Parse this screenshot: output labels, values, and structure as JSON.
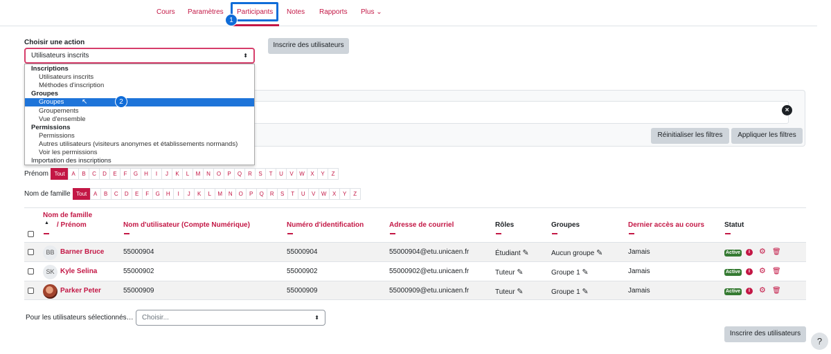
{
  "nav": {
    "items": [
      "Cours",
      "Paramètres",
      "Participants",
      "Notes",
      "Rapports",
      "Plus"
    ],
    "plus_caret": "⌄",
    "step1": "1"
  },
  "action": {
    "label": "Choisir une action",
    "selected": "Utilisateurs inscrits",
    "enrol_button": "Inscrire des utilisateurs"
  },
  "dropdown": {
    "rows": [
      {
        "type": "head",
        "label": "Inscriptions"
      },
      {
        "type": "item",
        "label": "Utilisateurs inscrits"
      },
      {
        "type": "item",
        "label": "Méthodes d'inscription"
      },
      {
        "type": "head",
        "label": "Groupes"
      },
      {
        "type": "sel",
        "label": "Groupes"
      },
      {
        "type": "item",
        "label": "Groupements"
      },
      {
        "type": "item",
        "label": "Vue d'ensemble"
      },
      {
        "type": "head",
        "label": "Permissions"
      },
      {
        "type": "item",
        "label": "Permissions"
      },
      {
        "type": "item",
        "label": "Autres utilisateurs (visiteurs anonymes et établissements normands)"
      },
      {
        "type": "item",
        "label": "Voir les permissions"
      },
      {
        "type": "plain",
        "label": "Importation des inscriptions"
      }
    ],
    "step2": "2"
  },
  "filters": {
    "clear": "×",
    "reset": "Réinitialiser les filtres",
    "apply": "Appliquer les filtres"
  },
  "initials": {
    "first_label": "Prénom",
    "last_label": "Nom de famille",
    "all": "Tout",
    "letters": [
      "A",
      "B",
      "C",
      "D",
      "E",
      "F",
      "G",
      "H",
      "I",
      "J",
      "K",
      "L",
      "M",
      "N",
      "O",
      "P",
      "Q",
      "R",
      "S",
      "T",
      "U",
      "V",
      "W",
      "X",
      "Y",
      "Z"
    ]
  },
  "table": {
    "headers": {
      "lastname": "Nom de famille",
      "sort_arrow": "▲",
      "firstname": "/ Prénom",
      "username": "Nom d'utilisateur (Compte Numérique)",
      "idnumber": "Numéro d'identification",
      "email": "Adresse de courriel",
      "roles": "Rôles",
      "groups": "Groupes",
      "lastaccess": "Dernier accès au cours",
      "status": "Statut"
    },
    "rows": [
      {
        "initials": "BB",
        "name": "Barner Bruce",
        "username": "55000904",
        "idnumber": "55000904",
        "email": "55000904@etu.unicaen.fr",
        "role": "Étudiant",
        "group": "Aucun groupe",
        "lastaccess": "Jamais",
        "status": "Active"
      },
      {
        "initials": "SK",
        "name": "Kyle Selina",
        "username": "55000902",
        "idnumber": "55000902",
        "email": "55000902@etu.unicaen.fr",
        "role": "Tuteur",
        "group": "Groupe 1",
        "lastaccess": "Jamais",
        "status": "Active"
      },
      {
        "initials": "",
        "name": "Parker Peter",
        "username": "55000909",
        "idnumber": "55000909",
        "email": "55000909@etu.unicaen.fr",
        "role": "Tuteur",
        "group": "Groupe 1",
        "lastaccess": "Jamais",
        "status": "Active"
      }
    ],
    "icons": {
      "edit": "✎",
      "info": "i",
      "gear": "⚙",
      "trash": "🗑"
    }
  },
  "bulk": {
    "label": "Pour les utilisateurs sélectionnés…",
    "placeholder": "Choisir..."
  },
  "footer": {
    "enrol_button": "Inscrire des utilisateurs",
    "help": "?"
  },
  "colors": {
    "accent": "#c31745",
    "highlight": "#0f6cd8",
    "active": "#357a32"
  }
}
